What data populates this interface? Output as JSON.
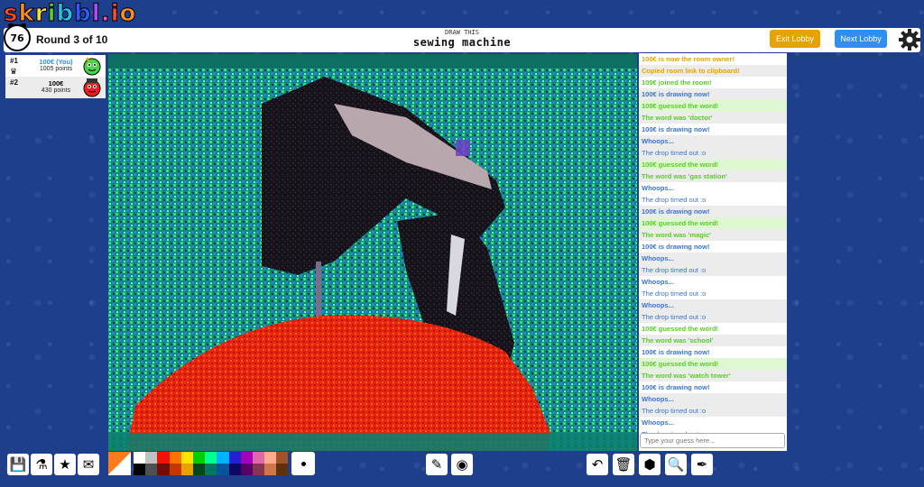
{
  "logo": {
    "letters": [
      "s",
      "k",
      "r",
      "i",
      "b",
      "b",
      "l",
      ".",
      "i",
      "o"
    ],
    "colors": [
      "#ff4b26",
      "#ff8d1a",
      "#ffe22b",
      "#5bd52e",
      "#1ec3f0",
      "#2e5bff",
      "#b14bff",
      "#ff54c4",
      "#ff4b26",
      "#ff8d1a"
    ]
  },
  "header": {
    "timer": "76",
    "round": "Round 3 of 10",
    "draw_this": "DRAW THIS",
    "word": "sewing machine",
    "exit_label": "Exit Lobby",
    "next_label": "Next Lobby"
  },
  "players": [
    {
      "rank": "#1",
      "name": "100€ (You)",
      "points": "1005 points",
      "name_color": "#2e8ff0"
    },
    {
      "rank": "#2",
      "name": "100€",
      "points": "430 points",
      "name_color": "#111111"
    }
  ],
  "chat": [
    {
      "text": "100€ is now the room owner!",
      "style": "orange",
      "bg": "white"
    },
    {
      "text": "Copied room link to clipboard!",
      "style": "orange",
      "bg": "alt"
    },
    {
      "text": "100€ joined the room!",
      "style": "green",
      "bg": "white"
    },
    {
      "text": "100€ is drawing now!",
      "style": "blue",
      "bg": "alt"
    },
    {
      "text": "100€ guessed the word!",
      "style": "green",
      "bg": "guess"
    },
    {
      "text": "The word was 'doctor'",
      "style": "green",
      "bg": "alt"
    },
    {
      "text": "100€ is drawing now!",
      "style": "blue",
      "bg": "white"
    },
    {
      "text": "Whoops...",
      "style": "blue",
      "bg": "alt"
    },
    {
      "text": "The drop timed out :o",
      "style": "sub",
      "bg": "alt"
    },
    {
      "text": "100€ guessed the word!",
      "style": "green",
      "bg": "guess"
    },
    {
      "text": "The word was 'gas station'",
      "style": "green",
      "bg": "alt"
    },
    {
      "text": "Whoops...",
      "style": "blue",
      "bg": "white"
    },
    {
      "text": "The drop timed out :o",
      "style": "sub",
      "bg": "white"
    },
    {
      "text": "100€ is drawing now!",
      "style": "blue",
      "bg": "alt"
    },
    {
      "text": "100€ guessed the word!",
      "style": "green",
      "bg": "guess"
    },
    {
      "text": "The word was 'magic'",
      "style": "green",
      "bg": "alt"
    },
    {
      "text": "100€ is drawing now!",
      "style": "blue",
      "bg": "white"
    },
    {
      "text": "Whoops...",
      "style": "blue",
      "bg": "alt"
    },
    {
      "text": "The drop timed out :o",
      "style": "sub",
      "bg": "alt"
    },
    {
      "text": "Whoops...",
      "style": "blue",
      "bg": "white"
    },
    {
      "text": "The drop timed out :o",
      "style": "sub",
      "bg": "white"
    },
    {
      "text": "Whoops...",
      "style": "blue",
      "bg": "alt"
    },
    {
      "text": "The drop timed out :o",
      "style": "sub",
      "bg": "alt"
    },
    {
      "text": "100€ guessed the word!",
      "style": "green",
      "bg": "white"
    },
    {
      "text": "The word was 'school'",
      "style": "green",
      "bg": "alt"
    },
    {
      "text": "100€ is drawing now!",
      "style": "blue",
      "bg": "white"
    },
    {
      "text": "100€ guessed the word!",
      "style": "green",
      "bg": "guess"
    },
    {
      "text": "The word was 'watch tower'",
      "style": "green",
      "bg": "alt"
    },
    {
      "text": "100€ is drawing now!",
      "style": "blue",
      "bg": "white"
    },
    {
      "text": "Whoops...",
      "style": "blue",
      "bg": "alt"
    },
    {
      "text": "The drop timed out :o",
      "style": "sub",
      "bg": "alt"
    },
    {
      "text": "Whoops...",
      "style": "blue",
      "bg": "white"
    },
    {
      "text": "The drop timed out :o",
      "style": "sub",
      "bg": "white"
    }
  ],
  "chat_input": {
    "placeholder": "Type your guess here..."
  },
  "palette": [
    "#ffffff",
    "#c1c1c1",
    "#ef130b",
    "#ff7100",
    "#ffe400",
    "#00cc00",
    "#00ff91",
    "#00b2ff",
    "#231fd3",
    "#a300ba",
    "#df69a7",
    "#ffac8e",
    "#a0522d",
    "#000000",
    "#505050",
    "#740b07",
    "#c23800",
    "#e8a200",
    "#004619",
    "#00785d",
    "#00569e",
    "#0e0865",
    "#550069",
    "#873554",
    "#cc774d",
    "#63300d"
  ],
  "tools_left": [
    {
      "name": "save-icon",
      "glyph": "💾"
    },
    {
      "name": "potion-icon",
      "glyph": "⚗"
    },
    {
      "name": "star-icon",
      "glyph": "★"
    },
    {
      "name": "mail-icon",
      "glyph": "✉"
    }
  ],
  "tools_mid": [
    {
      "name": "pencil-icon",
      "glyph": "✎"
    },
    {
      "name": "fill-bucket-icon",
      "glyph": "◉"
    }
  ],
  "tools_right": [
    {
      "name": "undo-icon",
      "glyph": "↶"
    },
    {
      "name": "trash-icon",
      "glyph": "🗑"
    },
    {
      "name": "cube-icon",
      "glyph": "⬢"
    },
    {
      "name": "zoom-icon",
      "glyph": "🔍"
    },
    {
      "name": "eyedropper-icon",
      "glyph": "✒"
    }
  ]
}
